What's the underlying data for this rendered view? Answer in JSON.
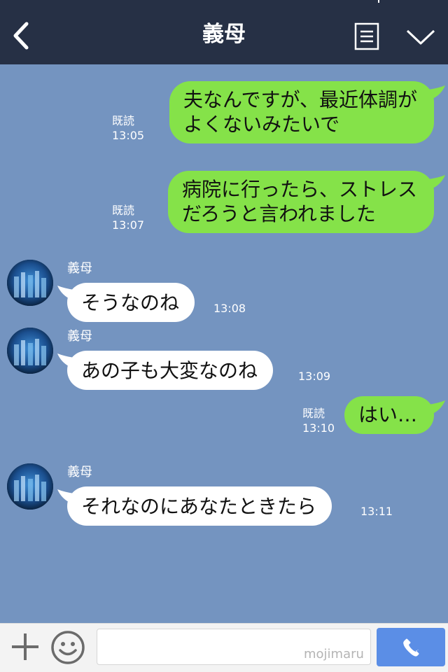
{
  "header": {
    "title": "義母"
  },
  "messages": [
    {
      "direction": "out",
      "text_lines": [
        "夫なんですが、最近体調が",
        "よくないみたいで"
      ],
      "read": "既読",
      "time": "13:05"
    },
    {
      "direction": "out",
      "text_lines": [
        "病院に行ったら、ストレス",
        "だろうと言われました"
      ],
      "read": "既読",
      "time": "13:07"
    },
    {
      "direction": "in",
      "sender": "義母",
      "text": "そうなのね",
      "time": "13:08"
    },
    {
      "direction": "in",
      "sender": "義母",
      "text": "あの子も大変なのね",
      "time": "13:09"
    },
    {
      "direction": "out",
      "text": "はい…",
      "read": "既読",
      "time": "13:10"
    },
    {
      "direction": "in",
      "sender": "義母",
      "text": "それなのにあなたときたら",
      "time": "13:11"
    }
  ],
  "composer": {
    "watermark": "mojimaru",
    "input_value": "",
    "placeholder": ""
  },
  "colors": {
    "header_bg": "#263045",
    "chat_bg": "#7494c0",
    "outgoing_bubble": "#85e249",
    "incoming_bubble": "#ffffff",
    "call_button": "#5b8ee6"
  },
  "icons": {
    "back": "back-chevron-icon",
    "menu": "document-list-icon",
    "collapse": "chevron-down-icon",
    "add": "plus-icon",
    "emoji": "smiley-icon",
    "call": "phone-icon"
  }
}
